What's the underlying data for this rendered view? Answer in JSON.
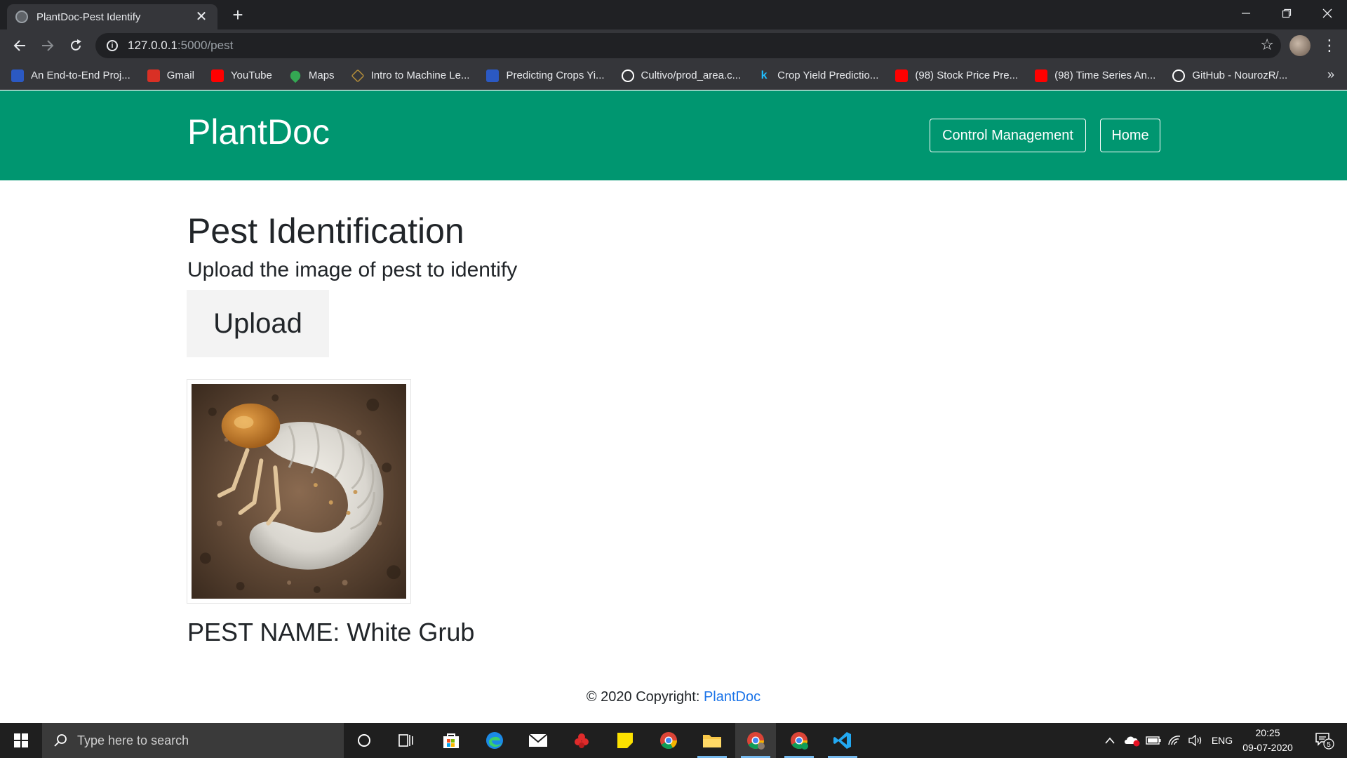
{
  "browser": {
    "tab_title": "PlantDoc-Pest Identify",
    "tab_close": "✕",
    "new_tab": "+",
    "url_host": "127.0.0.1",
    "url_rest": ":5000/pest",
    "bookmarks": [
      {
        "label": "An End-to-End Proj...",
        "icon": "tds-icon",
        "color": "#2b59c3"
      },
      {
        "label": "Gmail",
        "icon": "gmail-icon",
        "color": "#d93025"
      },
      {
        "label": "YouTube",
        "icon": "youtube-icon",
        "color": "#ff0000"
      },
      {
        "label": "Maps",
        "icon": "maps-icon",
        "color": "#34a853"
      },
      {
        "label": "Intro to Machine Le...",
        "icon": "udacity-icon",
        "color": "#b08b3a"
      },
      {
        "label": "Predicting Crops Yi...",
        "icon": "tds-icon",
        "color": "#2b59c3"
      },
      {
        "label": "Cultivo/prod_area.c...",
        "icon": "github-icon",
        "color": "#ffffff"
      },
      {
        "label": "Crop Yield Predictio...",
        "icon": "kaggle-icon",
        "color": "#20beff"
      },
      {
        "label": "(98) Stock Price Pre...",
        "icon": "youtube-icon",
        "color": "#ff0000"
      },
      {
        "label": "(98) Time Series An...",
        "icon": "youtube-icon",
        "color": "#ff0000"
      },
      {
        "label": "GitHub - NourozR/...",
        "icon": "github-icon",
        "color": "#ffffff"
      }
    ],
    "bookmarks_more": "»"
  },
  "page": {
    "brand": "PlantDoc",
    "nav": {
      "control_management": "Control Management",
      "home": "Home"
    },
    "title": "Pest Identification",
    "subtitle": "Upload the image of pest to identify",
    "upload_label": "Upload",
    "pest_name": "PEST NAME: White Grub",
    "footer_text": "© 2020 Copyright: ",
    "footer_link": "PlantDoc",
    "accent_color": "#009670"
  },
  "taskbar": {
    "search_placeholder": "Type here to search",
    "language": "ENG",
    "time": "20:25",
    "date": "09-07-2020",
    "notification_count": "5"
  }
}
